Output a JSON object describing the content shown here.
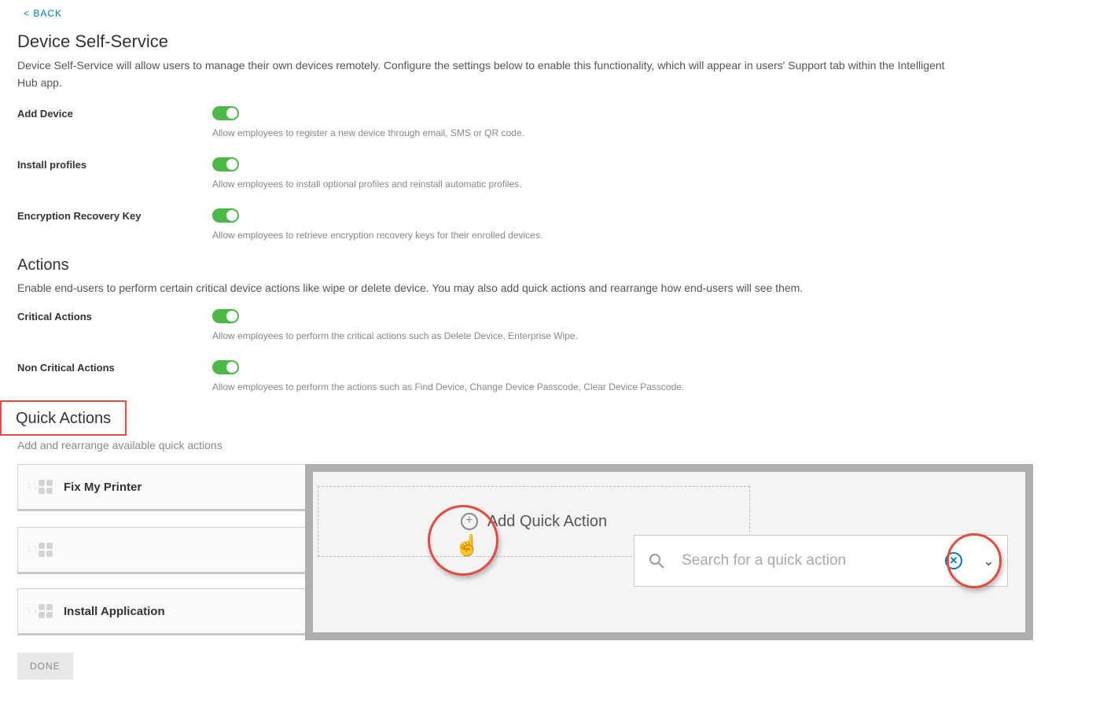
{
  "back": "< BACK",
  "deviceSelfService": {
    "title": "Device Self-Service",
    "desc": "Device Self-Service will allow users to manage their own devices remotely. Configure the settings below to enable this functionality, which will appear in users' Support tab within the Intelligent Hub app.",
    "settings": [
      {
        "label": "Add Device",
        "helper": "Allow employees to register a new device through email, SMS or QR code."
      },
      {
        "label": "Install profiles",
        "helper": "Allow employees to install optional profiles and reinstall automatic profiles."
      },
      {
        "label": "Encryption Recovery Key",
        "helper": "Allow employees to retrieve encryption recovery keys for their enrolled devices."
      }
    ]
  },
  "actions": {
    "title": "Actions",
    "desc": "Enable end-users to perform certain critical device actions like wipe or delete device. You may also add quick actions and rearrange how end-users will see them.",
    "settings": [
      {
        "label": "Critical Actions",
        "helper": "Allow employees to perform the critical actions such as Delete Device, Enterprise Wipe."
      },
      {
        "label": "Non Critical Actions",
        "helper": "Allow employees to perform the actions such as Find Device, Change Device Passcode, Clear Device Passcode."
      }
    ]
  },
  "quickActions": {
    "title": "Quick Actions",
    "desc": "Add and rearrange available quick actions",
    "tiles": [
      "Fix My Printer",
      "Install Application"
    ]
  },
  "done": "DONE",
  "overlay": {
    "addLabel": "Add Quick Action",
    "searchPlaceholder": "Search for a quick action"
  }
}
